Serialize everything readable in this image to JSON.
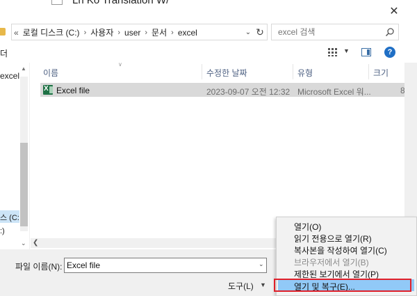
{
  "window": {
    "title": "Ln Ko Translation W/"
  },
  "address": {
    "breadcrumb_prefix": "«",
    "segments": [
      "로컬 디스크 (C:)",
      "사용자",
      "user",
      "문서",
      "excel"
    ]
  },
  "search": {
    "placeholder": "excel 검색"
  },
  "toolbar": {
    "fragment": "더",
    "help": "?"
  },
  "nav": {
    "items": [
      {
        "label": "excel"
      },
      {
        "label": "스 (C:)"
      },
      {
        "label": ":)"
      }
    ]
  },
  "columns": [
    "이름",
    "수정한 날짜",
    "유형",
    "크기"
  ],
  "files": [
    {
      "name": "Excel file",
      "modified": "2023-09-07 오전 12:32",
      "type": "Microsoft Excel 워...",
      "size": "8"
    }
  ],
  "bottom": {
    "filename_label": "파일 이름(N):",
    "filename_value": "Excel file",
    "tools_label": "도구(L)"
  },
  "open_menu": {
    "items": [
      {
        "label": "열기(O)",
        "enabled": true
      },
      {
        "label": "읽기 전용으로 열기(R)",
        "enabled": true
      },
      {
        "label": "복사본을 작성하여 열기(C)",
        "enabled": true
      },
      {
        "label": "브라우저에서 열기(B)",
        "enabled": false
      },
      {
        "label": "제한된 보기에서 열기(P)",
        "enabled": true
      },
      {
        "label": "열기 및 복구(E)...",
        "enabled": true,
        "selected": true
      }
    ]
  },
  "colors": {
    "accent": "#1f6fc5",
    "selection": "#91c9f7",
    "highlight_border": "#e0202a",
    "row_selected": "#d9d9d9"
  }
}
